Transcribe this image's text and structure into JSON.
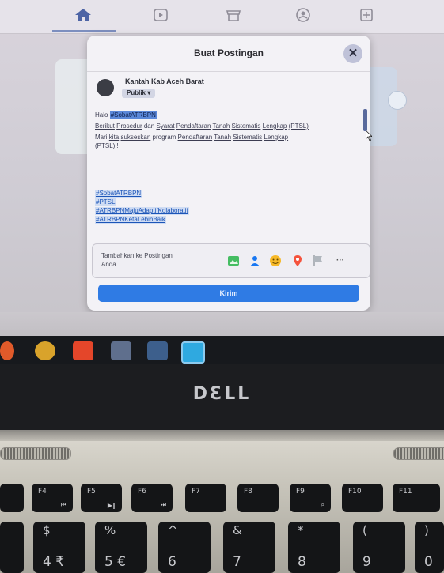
{
  "modal": {
    "title": "Buat Postingan",
    "close_glyph": "✕",
    "author": "Kantah Kab Aceh Barat",
    "audience": "Publik ▾",
    "line1_prefix": "Halo",
    "line1_hashtag": "#SobatATRBPN",
    "para1_lead": "Berikut",
    "para1_link1": "Prosedur",
    "para1_mid1": "dan",
    "para1_link2": "Syarat",
    "para1_link3": "Pendaftaran",
    "para1_link4": "Tanah",
    "para1_link5": "Sistematis",
    "para1_link6": "Lengkap",
    "para1_abbr": "(PTSL)",
    "para2_lead": "Mari",
    "para2_link1": "kita",
    "para2_link2": "sukseskan",
    "para2_mid": "program",
    "para2_link3": "Pendaftaran",
    "para2_link4": "Tanah",
    "para2_link5": "Sistematis",
    "para2_link6": "Lengkap",
    "para2_abbr": "(PTSL)!!",
    "hashtags": [
      "#SobatATRBPN",
      "#PTSL",
      "#ATRBPNMajuAdaptifKolaboratif",
      "#ATRBPNKetaLebihBaik"
    ],
    "add_to_post": "Tambahkan ke Postingan Anda",
    "more": "···",
    "submit": "Kirim"
  },
  "laptop": {
    "brand": "DƐLL",
    "keys": {
      "f4": "F4",
      "f4_icon": "⏮",
      "f5": "F5",
      "f5_icon": "▶‖",
      "f6": "F6",
      "f6_icon": "⏭",
      "f7": "F7",
      "f8": "F8",
      "f9": "F9",
      "f9_icon": "⌕",
      "f10": "F10",
      "f11": "F11",
      "k4_top": "$",
      "k4_bot": "4 ₹",
      "k5_top": "%",
      "k5_bot": "5 €",
      "k6_top": "^",
      "k6_bot": "6",
      "k7_top": "&",
      "k7_bot": "7",
      "k8_top": "*",
      "k8_bot": "8",
      "k9_top": "(",
      "k9_bot": "9",
      "k0_top": ")",
      "k0_bot": "0"
    }
  },
  "colors": {
    "accent": "#2f7be4",
    "highlight": "#5b88d9",
    "close": "#bfc2d8"
  },
  "icons": [
    "home-icon",
    "watch-icon",
    "marketplace-icon",
    "groups-icon",
    "gaming-icon",
    "photo-icon",
    "tag-people-icon",
    "feeling-icon",
    "location-icon",
    "flag-icon",
    "more-icon"
  ]
}
